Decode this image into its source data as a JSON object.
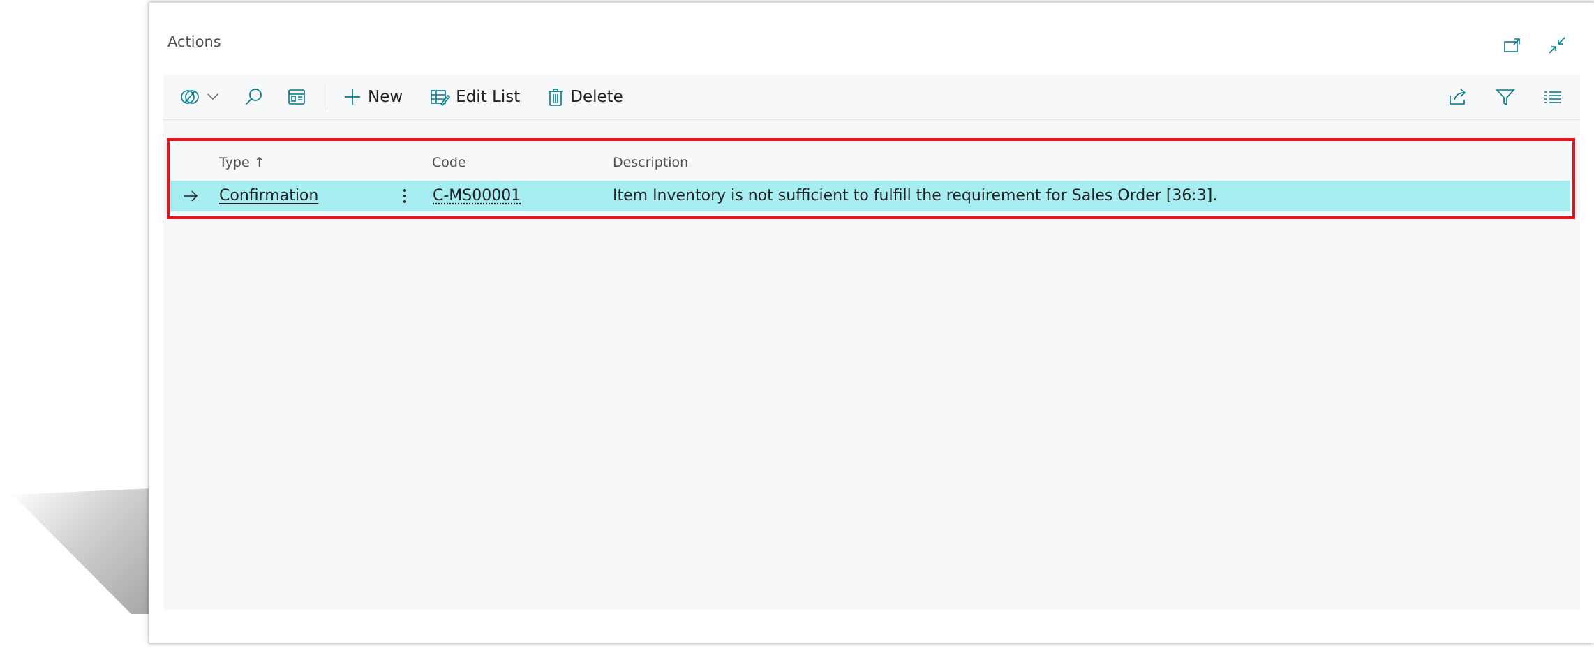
{
  "panel": {
    "title": "Actions"
  },
  "toolbar": {
    "new_label": "New",
    "edit_list_label": "Edit List",
    "delete_label": "Delete"
  },
  "table": {
    "columns": {
      "type": "Type",
      "sort_indicator": "↑",
      "code": "Code",
      "description": "Description"
    },
    "rows": [
      {
        "type": "Confirmation",
        "code": "C-MS00001",
        "description": "Item Inventory is not sufficient to fulfill the requirement for Sales Order [36:3]."
      }
    ]
  },
  "colors": {
    "accent": "#00798a",
    "selected_row": "#a7eef3",
    "highlight_border": "#e2161c"
  }
}
